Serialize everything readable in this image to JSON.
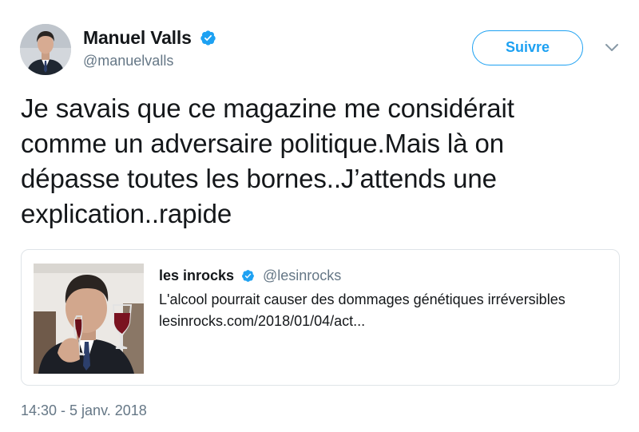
{
  "author": {
    "display_name": "Manuel Valls",
    "handle": "@manuelvalls",
    "verified": true,
    "avatar_icon": "profile-photo"
  },
  "actions": {
    "follow_label": "Suivre",
    "menu_icon": "chevron-down-icon"
  },
  "tweet": {
    "text": "Je savais que ce magazine me considérait comme un adversaire politique.Mais là on dépasse toutes les bornes..J’attends une explication..rapide",
    "timestamp": "14:30 - 5 janv. 2018"
  },
  "quoted_tweet": {
    "display_name": "les inrocks",
    "handle": "@lesinrocks",
    "verified": true,
    "text_line1": "L'alcool pourrait causer des dommages génétiques irréversibles",
    "text_line2": "lesinrocks.com/2018/01/04/act..."
  },
  "colors": {
    "accent": "#1da1f2",
    "text_primary": "#14171a",
    "text_secondary": "#657786",
    "border": "#dfe4e8"
  }
}
